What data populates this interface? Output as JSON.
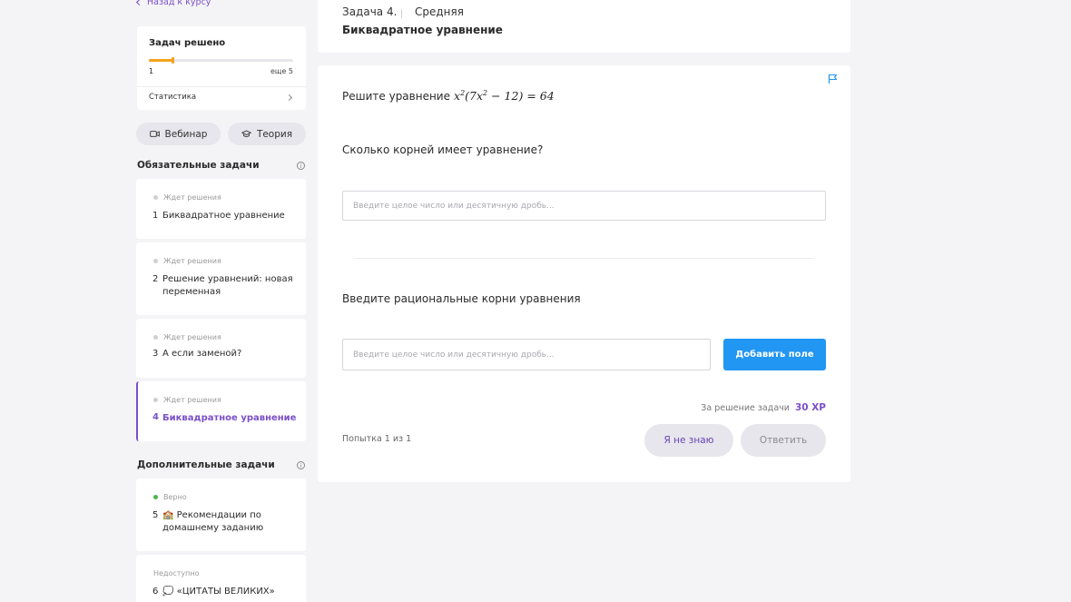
{
  "nav": {
    "back_label": "Назад к курсу"
  },
  "progress": {
    "title": "Задач решено",
    "solved": "1",
    "remaining": "еще 5",
    "fraction": 0.17,
    "accent_color": "#f4a21b",
    "stats_label": "Статистика"
  },
  "pills": {
    "webinar": "Вебинар",
    "theory": "Теория"
  },
  "sections": {
    "required": "Обязательные задачи",
    "extra": "Дополнительные задачи"
  },
  "required_tasks": [
    {
      "status": "Ждет решения",
      "num": "1",
      "name": "Биквадратное уравнение"
    },
    {
      "status": "Ждет решения",
      "num": "2",
      "name": "Решение уравнений: новая переменная"
    },
    {
      "status": "Ждет решения",
      "num": "3",
      "name": "А если заменой?"
    },
    {
      "status": "Ждет решения",
      "num": "4",
      "name": "Биквадратное уравнение"
    }
  ],
  "extra_tasks": [
    {
      "status": "Верно",
      "num": "5",
      "name": "🏫 Рекомендации по домашнему заданию"
    },
    {
      "status": "Недоступно",
      "num": "6",
      "name": "💭 «ЦИТАТЫ ВЕЛИКИХ»"
    }
  ],
  "header": {
    "task_number": "Задача 4.",
    "level": "Средняя",
    "task_name": "Биквадратное уравнение"
  },
  "problem": {
    "intro": "Решите уравнение",
    "question1": "Сколько корней имеет уравнение?",
    "question2": "Введите рациональные корни уравнения",
    "placeholder": "Введите целое число или десятичную дробь..."
  },
  "actions": {
    "add_field": "Добавить поле",
    "reward_label": "За решение задачи",
    "reward_xp": "30 XP",
    "attempt": "Попытка 1 из 1",
    "dont_know": "Я не знаю",
    "answer": "Ответить"
  },
  "colors": {
    "accent_purple": "#7a4fc8",
    "primary_blue": "#2196f3",
    "success_green": "#4cb54a"
  }
}
